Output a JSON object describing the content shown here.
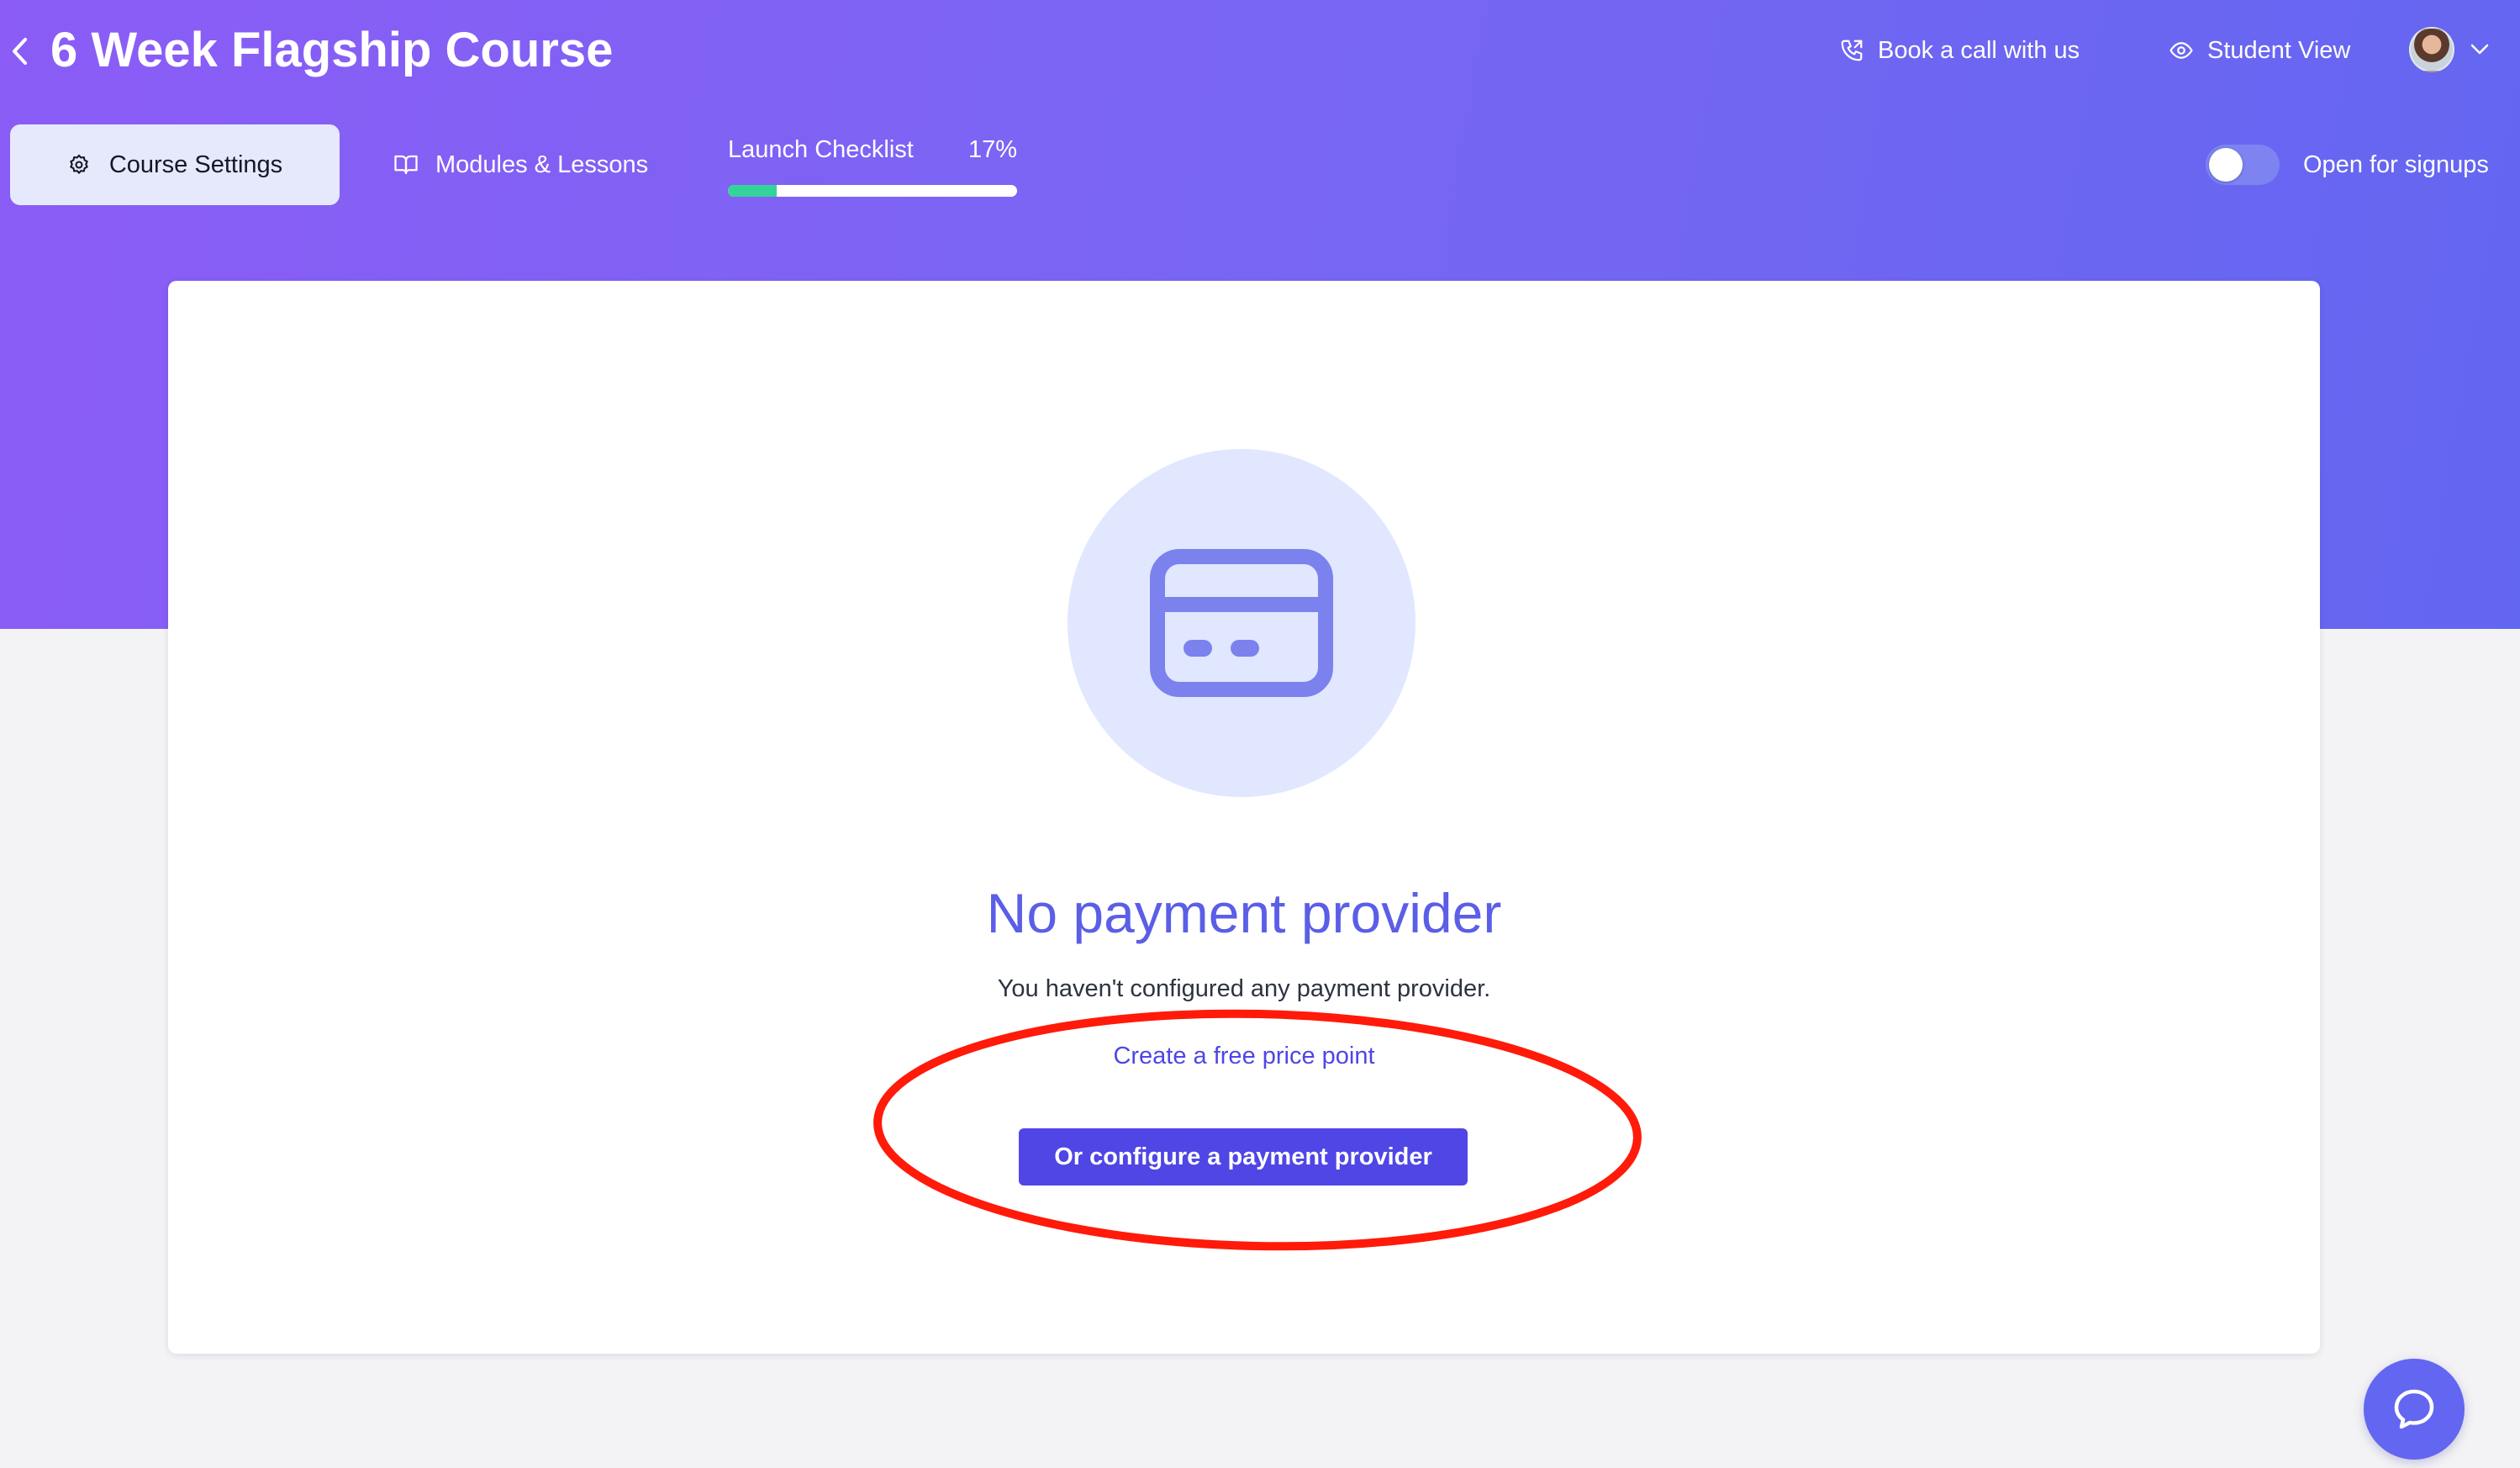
{
  "header": {
    "title": "6 Week Flagship Course",
    "back_icon": "chevron-left-icon",
    "book_call_label": "Book a call with us",
    "student_view_label": "Student View"
  },
  "tabs": [
    {
      "label": "Course Settings",
      "icon": "gear-icon",
      "active": true
    },
    {
      "label": "Modules & Lessons",
      "icon": "book-icon",
      "active": false
    }
  ],
  "checklist": {
    "label": "Launch Checklist",
    "percent_label": "17%",
    "progress_percent": 17
  },
  "signup_toggle": {
    "label": "Open for signups",
    "on": false
  },
  "empty_state": {
    "icon": "credit-card-icon",
    "title": "No payment provider",
    "description": "You haven't configured any payment provider.",
    "free_link": "Create a free price point",
    "configure_button": "Or configure a payment provider"
  },
  "colors": {
    "accent": "#4f46e5",
    "header_gradient_start": "#8b5cf6",
    "header_gradient_end": "#6366f1",
    "progress": "#34d399",
    "annotation": "#ff1a0a"
  }
}
